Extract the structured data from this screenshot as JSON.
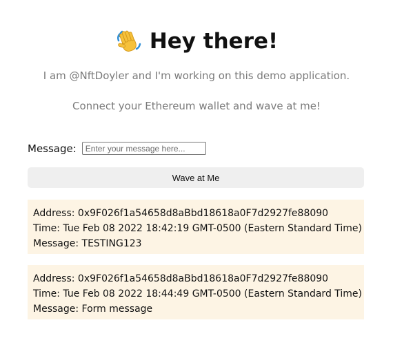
{
  "header": {
    "title": "Hey there!",
    "emoji": "waving-hand-icon"
  },
  "bio": "I am @NftDoyler and I'm working on this demo application.",
  "connect_prompt": "Connect your Ethereum wallet and wave at me!",
  "form": {
    "label": "Message:",
    "input_value": "",
    "input_placeholder": "Enter your message here...",
    "button_label": "Wave at Me"
  },
  "waves": [
    {
      "address": "Address: 0x9F026f1a54658d8aBbd18618a0F7d2927fe88090",
      "time": "Time: Tue Feb 08 2022 18:42:19 GMT-0500 (Eastern Standard Time)",
      "message": "Message: TESTING123"
    },
    {
      "address": "Address: 0x9F026f1a54658d8aBbd18618a0F7d2927fe88090",
      "time": "Time: Tue Feb 08 2022 18:44:49 GMT-0500 (Eastern Standard Time)",
      "message": "Message: Form message"
    }
  ],
  "colors": {
    "card_background": "#fdf4e4",
    "button_background": "#efefef",
    "muted_text": "#7a7a7a"
  }
}
